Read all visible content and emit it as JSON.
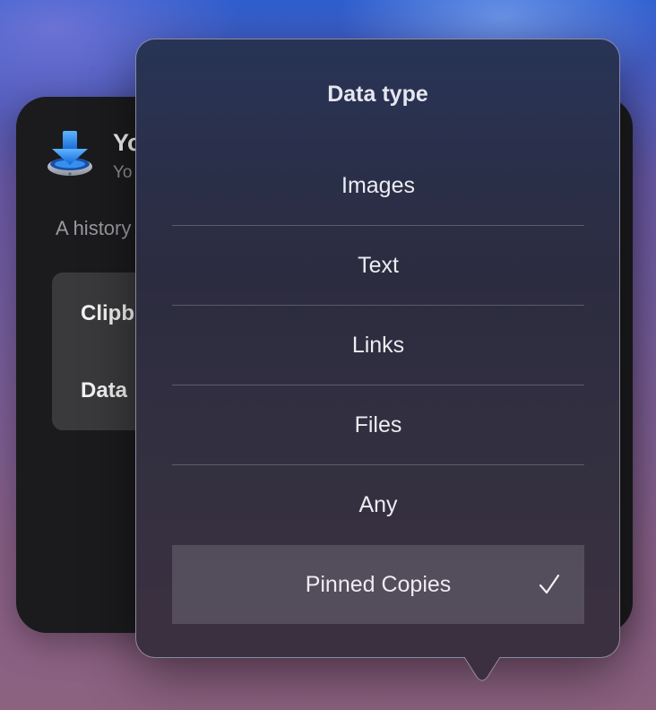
{
  "widget": {
    "title": "Yo",
    "subtitle": "Yo",
    "description": "A history",
    "settings": [
      {
        "label": "Clipb"
      },
      {
        "label": "Data"
      }
    ]
  },
  "popover": {
    "title": "Data type",
    "items": [
      {
        "label": "Images",
        "selected": false
      },
      {
        "label": "Text",
        "selected": false
      },
      {
        "label": "Links",
        "selected": false
      },
      {
        "label": "Files",
        "selected": false
      },
      {
        "label": "Any",
        "selected": false
      },
      {
        "label": "Pinned Copies",
        "selected": true
      }
    ]
  },
  "icons": {
    "app": "download-tray-icon",
    "selected_marker": "checkmark-icon"
  },
  "colors": {
    "app_icon_blue": "#2f8cff",
    "widget_background": "#1b1b1d",
    "card_background": "#3a3a3c"
  }
}
